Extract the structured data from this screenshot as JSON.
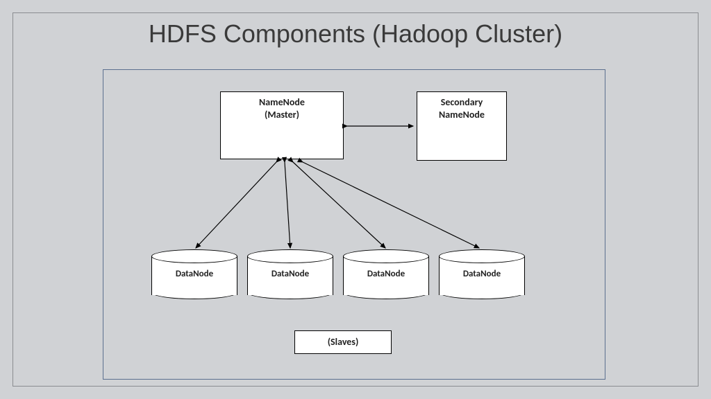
{
  "title": "HDFS Components (Hadoop Cluster)",
  "namenode": {
    "line1": "NameNode",
    "line2": "(Master)"
  },
  "secondary": {
    "line1": "Secondary",
    "line2": "NameNode"
  },
  "datanode_label": "DataNode",
  "slaves_label": "(Slaves)"
}
